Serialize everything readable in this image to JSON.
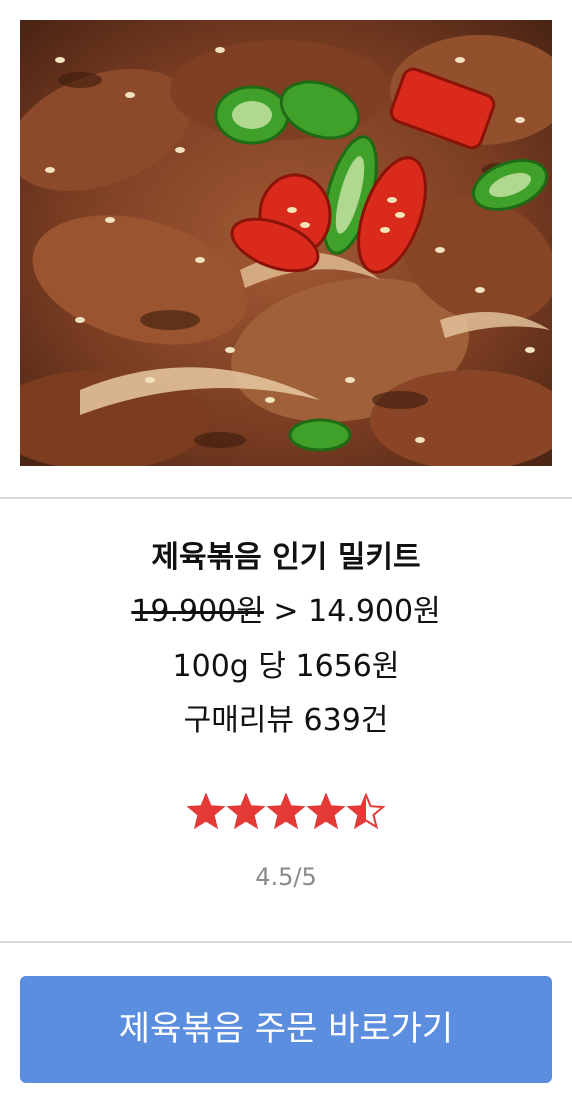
{
  "product": {
    "image_alt": "제육볶음",
    "title": "제육볶음 인기 밀키트",
    "original_price": "19.900원",
    "price_separator": " > ",
    "sale_price": "14.900원",
    "unit_price": "100g 당 1656원",
    "review_count": "구매리뷰 639건"
  },
  "rating": {
    "value": 4.5,
    "max": 5,
    "label": "4.5/5",
    "star_color": "#e53935"
  },
  "cta": {
    "label": "제육볶음 주문 바로가기",
    "color": "#5b8ede"
  }
}
